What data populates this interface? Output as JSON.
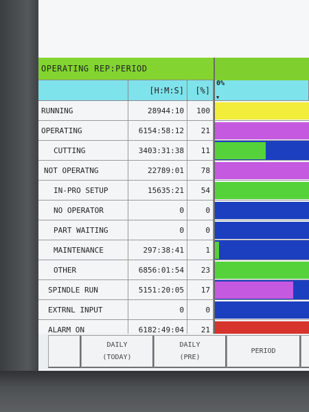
{
  "title": "OPERATING REP:PERIOD",
  "headers": {
    "time": "[H:M:S]",
    "percent": "[%]",
    "bar_zero": "0%"
  },
  "rows": [
    {
      "label": "RUNNING",
      "time": "28944:10",
      "percent": "100",
      "bar_color": "#f2ec3a"
    },
    {
      "label": "OPERATING",
      "time": "6154:58:12",
      "percent": "21",
      "bar_color": "#c55ae0"
    },
    {
      "label": "CUTTING",
      "time": "3403:31:38",
      "percent": "11",
      "bar_color": "#55d23a",
      "bar_bg": "#1c3fc0"
    },
    {
      "label": "NOT OPERATNG",
      "time": "22789:01",
      "percent": "78",
      "bar_color": "#c55ae0"
    },
    {
      "label": "IN-PRO SETUP",
      "time": "15635:21",
      "percent": "54",
      "bar_color": "#55d23a"
    },
    {
      "label": "NO OPERATOR",
      "time": "0",
      "percent": "0",
      "bar_color": "#1c3fc0"
    },
    {
      "label": "PART WAITING",
      "time": "0",
      "percent": "0",
      "bar_color": "#1c3fc0"
    },
    {
      "label": "MAINTENANCE",
      "time": "297:38:41",
      "percent": "1",
      "bar_color": "#55d23a",
      "bar_bg": "#1c3fc0"
    },
    {
      "label": "OTHER",
      "time": "6856:01:54",
      "percent": "23",
      "bar_color": "#55d23a"
    },
    {
      "label": "SPINDLE RUN",
      "time": "5151:20:05",
      "percent": "17",
      "bar_color": "#c55ae0",
      "bar_bg": "#1c3fc0"
    },
    {
      "label": "EXTRNL INPUT",
      "time": "0",
      "percent": "0",
      "bar_color": "#1c3fc0"
    },
    {
      "label": "ALARM ON",
      "time": "6182:49:04",
      "percent": "21",
      "bar_color": "#d8342e"
    }
  ],
  "softkeys": [
    {
      "line1": "",
      "line2": ""
    },
    {
      "line1": "DAILY",
      "line2": "(TODAY)"
    },
    {
      "line1": "DAILY",
      "line2": "(PRE)"
    },
    {
      "line1": "PERIOD",
      "line2": ""
    }
  ]
}
